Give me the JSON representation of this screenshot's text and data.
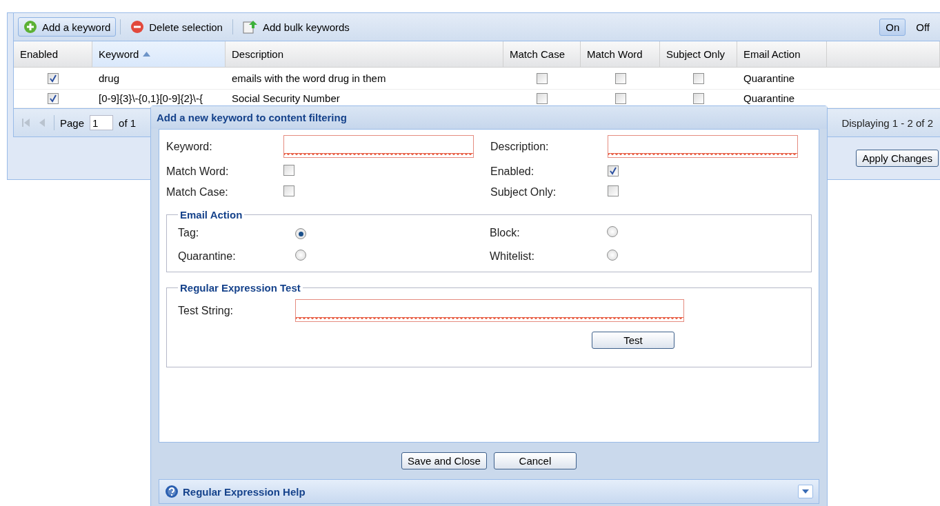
{
  "toolbar": {
    "buttons": [
      {
        "label": "Add a keyword",
        "pressed": true
      },
      {
        "label": "Delete selection",
        "pressed": false
      },
      {
        "label": "Add bulk keywords",
        "pressed": false
      }
    ],
    "toggle": [
      {
        "label": "On",
        "selected": true
      },
      {
        "label": "Off",
        "selected": false
      }
    ]
  },
  "grid": {
    "columns": [
      {
        "label": "Enabled",
        "sorted": false
      },
      {
        "label": "Keyword",
        "sorted": true
      },
      {
        "label": "Description",
        "sorted": false
      },
      {
        "label": "Match Case",
        "sorted": false
      },
      {
        "label": "Match Word",
        "sorted": false
      },
      {
        "label": "Subject Only",
        "sorted": false
      },
      {
        "label": "Email Action",
        "sorted": false
      }
    ],
    "rows": [
      {
        "enabled": true,
        "keyword": "drug",
        "description": "emails with the word drug in them",
        "match_case": false,
        "match_word": false,
        "subject_only": false,
        "email_action": "Quarantine"
      },
      {
        "enabled": true,
        "keyword": "[0-9]{3}\\-{0,1}[0-9]{2}\\-{",
        "description": "Social Security Number",
        "match_case": false,
        "match_word": false,
        "subject_only": false,
        "email_action": "Quarantine"
      }
    ]
  },
  "paging": {
    "page_label": "Page",
    "page_value": "1",
    "of_label": "of 1",
    "display": "Displaying 1 - 2 of 2"
  },
  "apply_button": "Apply Changes",
  "dialog": {
    "title": "Add a new keyword to content filtering",
    "fields": [
      {
        "kind": "text",
        "label": "Keyword:",
        "invalid": true
      },
      {
        "kind": "text",
        "label": "Description:",
        "invalid": true
      },
      {
        "kind": "check",
        "label": "Match Word:",
        "checked": false
      },
      {
        "kind": "check",
        "label": "Enabled:",
        "checked": true
      },
      {
        "kind": "check",
        "label": "Match Case:",
        "checked": false
      },
      {
        "kind": "check",
        "label": "Subject Only:",
        "checked": false
      }
    ],
    "email_action": {
      "legend": "Email Action",
      "options": [
        {
          "label": "Tag:",
          "selected": true
        },
        {
          "label": "Block:",
          "selected": false
        },
        {
          "label": "Quarantine:",
          "selected": false
        },
        {
          "label": "Whitelist:",
          "selected": false
        }
      ]
    },
    "regex_test": {
      "legend": "Regular Expression Test",
      "label": "Test String:",
      "invalid": true,
      "button": "Test"
    },
    "buttons": [
      "Save and Close",
      "Cancel"
    ],
    "help": {
      "title": "Regular Expression Help",
      "expanded": false
    }
  }
}
